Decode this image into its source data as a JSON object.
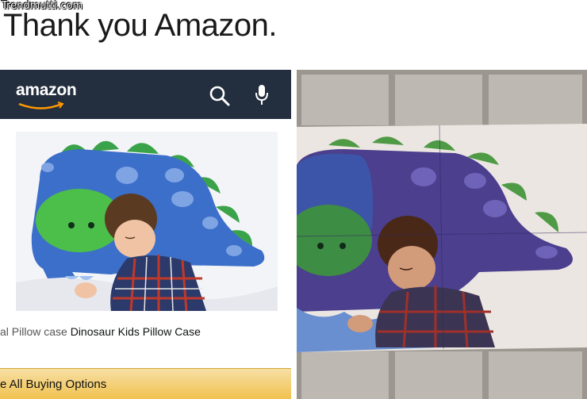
{
  "watermark": "Trendmutti.com",
  "caption": "Thank you Amazon.",
  "amazon": {
    "logo": "amazon",
    "product_title_prefix": "al Pillow case ",
    "product_title": "Dinosaur Kids Pillow Case",
    "buy_button": "e All Buying Options"
  },
  "colors": {
    "header_bg": "#232f3e",
    "smile": "#ff9900",
    "buy_bar": "#f0c14b",
    "pillow_blue": "#3b6fc9",
    "spike_green": "#3aa34a",
    "real_purple": "#4b3f8e"
  },
  "icons": [
    "search-icon",
    "mic-icon"
  ]
}
